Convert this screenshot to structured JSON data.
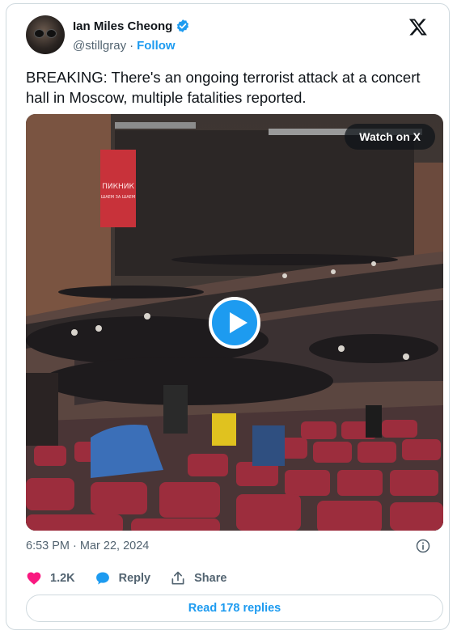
{
  "author": {
    "name": "Ian Miles Cheong",
    "handle": "@stillgray",
    "separator": "·",
    "follow_label": "Follow"
  },
  "tweet": {
    "text": "BREAKING: There's an ongoing terrorist attack at a concert hall in Moscow, multiple fatalities reported.",
    "timestamp": "6:53 PM · Mar 22, 2024"
  },
  "media": {
    "watch_label": "Watch on X",
    "screen_text_line1": "ПИКНИК",
    "screen_text_line2": "ШАЕМ ЗА ШАЕМ"
  },
  "actions": {
    "likes_count": "1.2K",
    "reply_label": "Reply",
    "share_label": "Share"
  },
  "replies_button": "Read 178 replies",
  "colors": {
    "accent": "#1d9bf0",
    "like": "#f91880",
    "muted": "#536471"
  }
}
